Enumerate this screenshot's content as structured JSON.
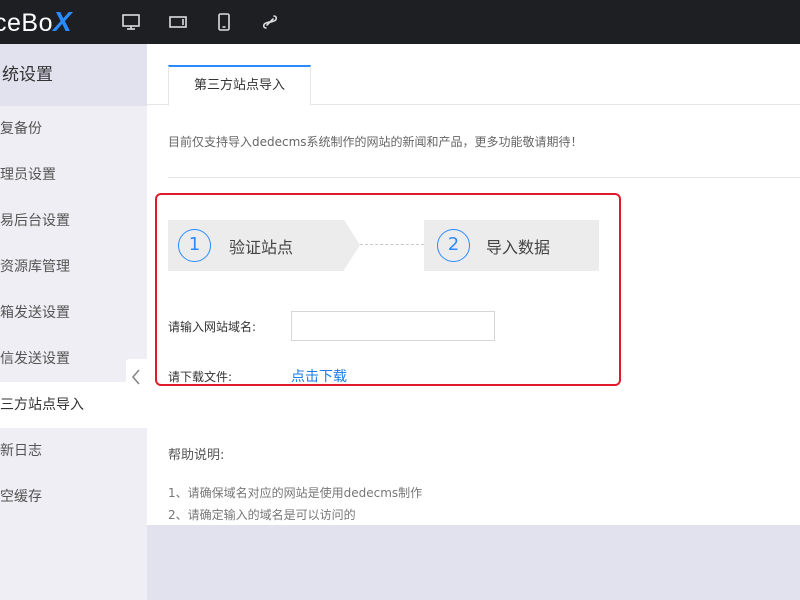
{
  "topbar": {
    "logo_text": "ceBo",
    "logo_x": "X",
    "icons": [
      "monitor-icon",
      "tablet-landscape-icon",
      "phone-icon",
      "link-icon"
    ]
  },
  "sidebar": {
    "title": "统设置",
    "items": [
      {
        "label": "复备份",
        "active": false
      },
      {
        "label": "理员设置",
        "active": false
      },
      {
        "label": "易后台设置",
        "active": false
      },
      {
        "label": "资源库管理",
        "active": false
      },
      {
        "label": "箱发送设置",
        "active": false
      },
      {
        "label": "信发送设置",
        "active": false
      },
      {
        "label": "三方站点导入",
        "active": true
      },
      {
        "label": "新日志",
        "active": false
      },
      {
        "label": "空缓存",
        "active": false
      }
    ]
  },
  "main": {
    "tab_label": "第三方站点导入",
    "notice": "目前仅支持导入dedecms系统制作的网站的新闻和产品，更多功能敬请期待！",
    "steps": [
      {
        "number": "1",
        "label": "验证站点"
      },
      {
        "number": "2",
        "label": "导入数据"
      }
    ],
    "domain_label": "请输入网站域名:",
    "domain_value": "",
    "domain_placeholder": "",
    "download_label": "请下载文件:",
    "download_link": "点击下载",
    "help_title": "帮助说明:",
    "help_lines": [
      "1、请确保域名对应的网站是使用dedecms制作",
      "2、请确定输入的域名是可以访问的"
    ]
  },
  "colors": {
    "accent": "#2a8bff",
    "highlight_border": "#e11a2b",
    "topbar_bg": "#1e1f23",
    "sidebar_bg": "#eeeef4"
  }
}
